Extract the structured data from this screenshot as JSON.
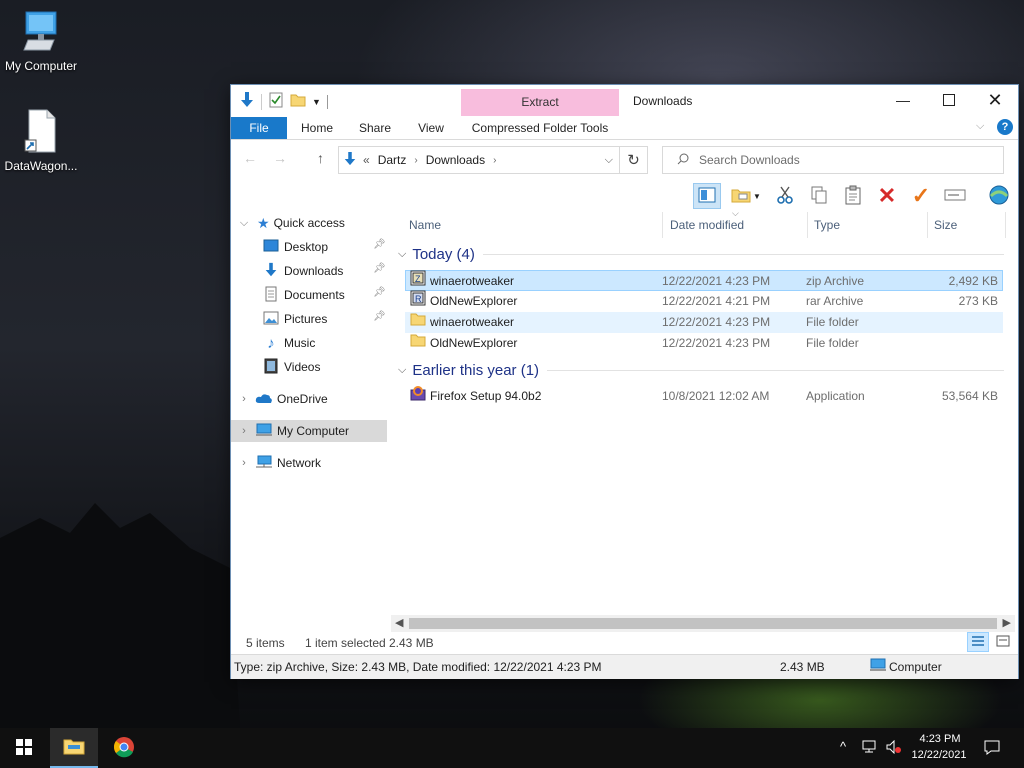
{
  "desktop": {
    "icons": [
      {
        "label": "My Computer",
        "icon": "computer-icon"
      },
      {
        "label": "DataWagon...",
        "icon": "file-shortcut-icon"
      }
    ]
  },
  "window": {
    "title": "Downloads",
    "contextual_tab": "Extract",
    "ribbon_tabs": [
      "File",
      "Home",
      "Share",
      "View",
      "Compressed Folder Tools"
    ],
    "address": {
      "prefix": "«",
      "segments": [
        "Dartz",
        "Downloads"
      ]
    },
    "search_placeholder": "Search Downloads"
  },
  "sidebar": {
    "items": [
      {
        "label": "Quick access",
        "icon": "star-icon"
      },
      {
        "label": "Desktop",
        "icon": "desktop-folder-icon",
        "pinned": true
      },
      {
        "label": "Downloads",
        "icon": "download-arrow-icon",
        "pinned": true
      },
      {
        "label": "Documents",
        "icon": "documents-icon",
        "pinned": true
      },
      {
        "label": "Pictures",
        "icon": "pictures-icon",
        "pinned": true
      },
      {
        "label": "Music",
        "icon": "music-note-icon"
      },
      {
        "label": "Videos",
        "icon": "videos-icon"
      },
      {
        "label": "OneDrive",
        "icon": "cloud-icon"
      },
      {
        "label": "My Computer",
        "icon": "computer-icon"
      },
      {
        "label": "Network",
        "icon": "network-icon"
      }
    ]
  },
  "columns": [
    "Name",
    "Date modified",
    "Type",
    "Size"
  ],
  "groups": [
    {
      "label": "Today (4)",
      "files": [
        {
          "name": "winaerotweaker",
          "date": "12/22/2021 4:23 PM",
          "type": "zip Archive",
          "size": "2,492 KB",
          "icon": "zip-archive-icon"
        },
        {
          "name": "OldNewExplorer",
          "date": "12/22/2021 4:21 PM",
          "type": "rar Archive",
          "size": "273 KB",
          "icon": "rar-archive-icon"
        },
        {
          "name": "winaerotweaker",
          "date": "12/22/2021 4:23 PM",
          "type": "File folder",
          "size": "",
          "icon": "folder-icon"
        },
        {
          "name": "OldNewExplorer",
          "date": "12/22/2021 4:23 PM",
          "type": "File folder",
          "size": "",
          "icon": "folder-icon"
        }
      ]
    },
    {
      "label": "Earlier this year (1)",
      "files": [
        {
          "name": "Firefox Setup 94.0b2",
          "date": "10/8/2021 12:02 AM",
          "type": "Application",
          "size": "53,564 KB",
          "icon": "firefox-installer-icon"
        }
      ]
    }
  ],
  "status": {
    "items_count": "5 items",
    "selected": "1 item selected",
    "selected_size": "2.43 MB"
  },
  "infobar": {
    "details": "Type: zip Archive, Size: 2.43 MB, Date modified: 12/22/2021 4:23 PM",
    "size": "2.43 MB",
    "location": "Computer"
  },
  "taskbar": {
    "time": "4:23 PM",
    "date": "12/22/2021"
  },
  "colors": {
    "file_tab": "#1979ca",
    "context_tab": "#f8bddd",
    "selection": "#cce8ff",
    "group_header": "#1e3287"
  }
}
